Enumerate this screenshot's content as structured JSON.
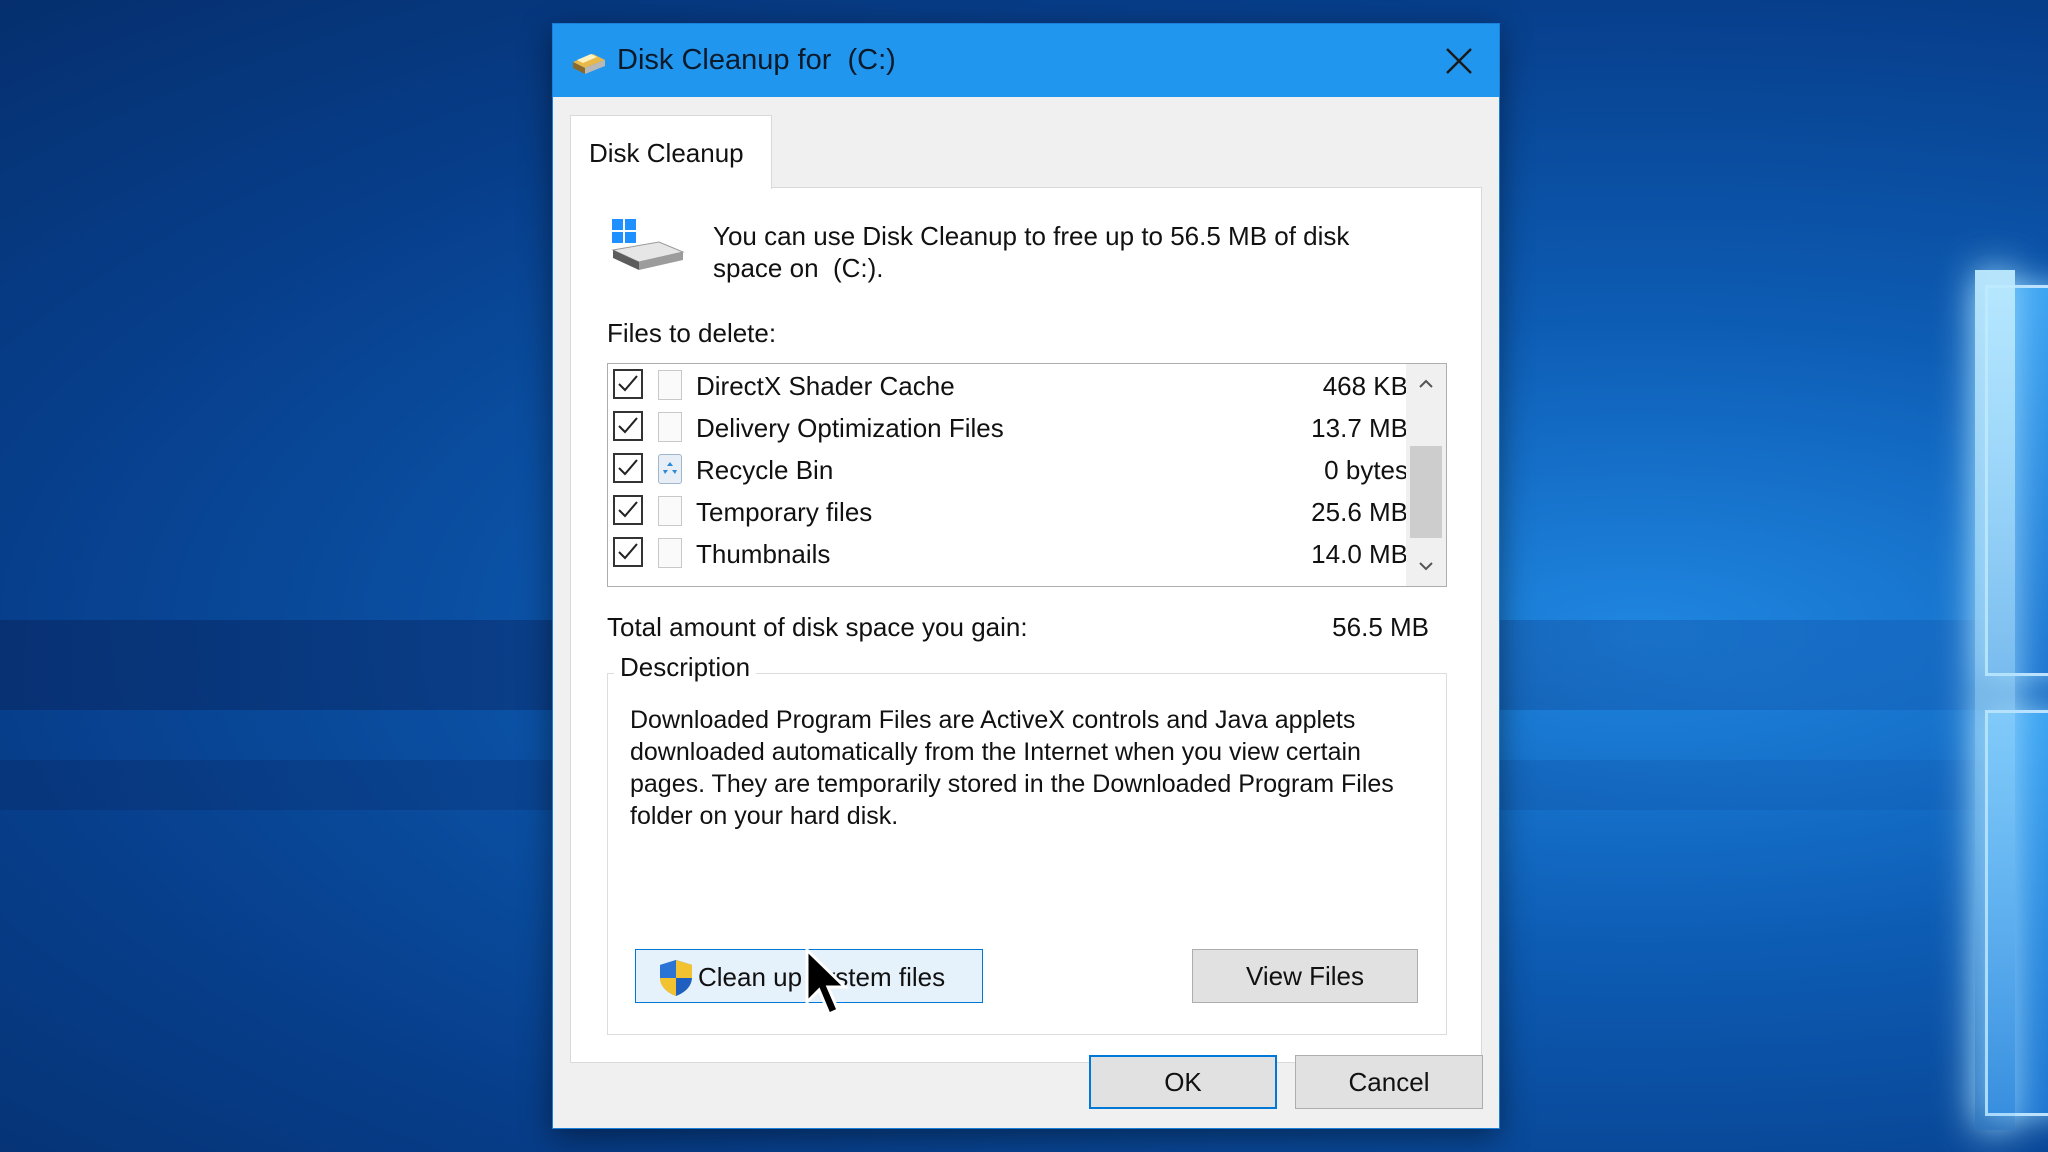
{
  "window": {
    "title": "Disk Cleanup for  (C:)",
    "close_icon": "close-icon",
    "accent": "#2196ee"
  },
  "tab": {
    "label": "Disk Cleanup"
  },
  "intro": {
    "text": "You can use Disk Cleanup to free up to 56.5 MB of disk\nspace on  (C:)."
  },
  "files": {
    "label": "Files to delete:",
    "items": [
      {
        "name": "DirectX Shader Cache",
        "size": "468 KB",
        "checked": true,
        "icon": "file-icon"
      },
      {
        "name": "Delivery Optimization Files",
        "size": "13.7 MB",
        "checked": true,
        "icon": "file-icon"
      },
      {
        "name": "Recycle Bin",
        "size": "0 bytes",
        "checked": true,
        "icon": "recycle-bin-icon"
      },
      {
        "name": "Temporary files",
        "size": "25.6 MB",
        "checked": true,
        "icon": "file-icon"
      },
      {
        "name": "Thumbnails",
        "size": "14.0 MB",
        "checked": true,
        "icon": "file-icon"
      }
    ]
  },
  "total": {
    "label": "Total amount of disk space you gain:",
    "value": "56.5 MB"
  },
  "description": {
    "legend": "Description",
    "text": "Downloaded Program Files are ActiveX controls and Java applets downloaded automatically from the Internet when you view certain pages. They are temporarily stored in the Downloaded Program Files folder on your hard disk.",
    "cleanup_button": "Clean up system files",
    "view_files_button": "View Files"
  },
  "footer": {
    "ok": "OK",
    "cancel": "Cancel"
  }
}
